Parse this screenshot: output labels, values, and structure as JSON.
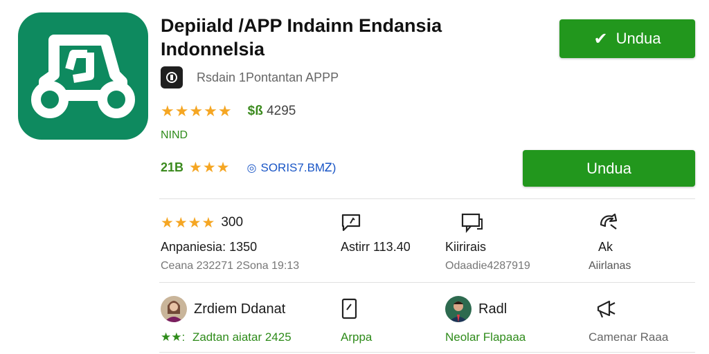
{
  "app": {
    "title": "Depiiald /APP Indainn Endansia Indonnelsia",
    "developer": "Rsdain  1Pontantan APPP",
    "icon": "car-icon",
    "icon_color": "#0e8a5f"
  },
  "rating": {
    "stars_text": "★★★★★",
    "value": 4.5,
    "price_currency": "$",
    "price_value": "4295",
    "price_prefix_glyph": "$ß"
  },
  "region_label": "NIND",
  "stats": {
    "downloads": "21B",
    "stars_text": "★★★",
    "link_text": "SORIS7.BMᏃ)"
  },
  "buttons": {
    "primary": "Undua",
    "secondary": "Undua",
    "accent": "#22971d"
  },
  "grid_row1": {
    "col1": {
      "stars_text": "★★★★",
      "count": "300",
      "line2": "Anpaniesia: 1350",
      "line3": "Ceana 232271 2Sona 19:13"
    },
    "col2": {
      "icon": "chat-icon",
      "line2": "Astirr 113.40"
    },
    "col3": {
      "icon": "message-icon",
      "line2": "Kiirirais",
      "line3": "Odaadie4287919"
    },
    "col4": {
      "icon": "share-icon",
      "line2": "Ak",
      "line3": "Aiirlanas"
    }
  },
  "grid_row2": {
    "col1": {
      "name": "Zrdiem Ddanat",
      "stars_text": "★★:",
      "subtext": "Zadtan aiatar 2425"
    },
    "col2": {
      "icon": "phone-icon",
      "subtext": "Arppa"
    },
    "col3": {
      "name": "Radl",
      "subtext": "Neolar Flapaaa"
    },
    "col4": {
      "icon": "megaphone-icon",
      "subtext": "Camenar Raaa"
    }
  }
}
